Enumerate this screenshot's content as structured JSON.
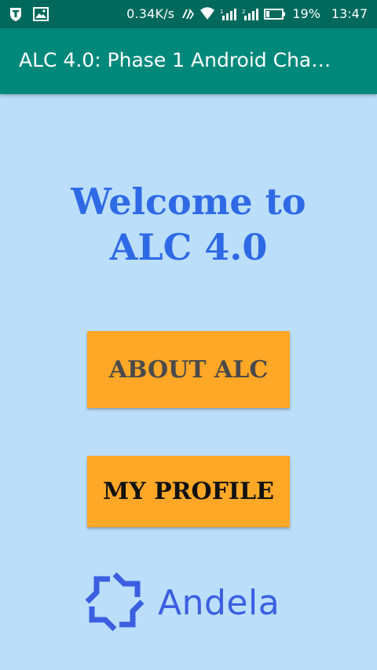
{
  "status_bar": {
    "network_speed": "0.34K/s",
    "battery": "19%",
    "time": "13:47",
    "icons": [
      "shield-notification-icon",
      "image-notification-icon",
      "data-sync-icon",
      "wifi-icon",
      "signal-icon",
      "signal-icon",
      "battery-icon"
    ]
  },
  "app_bar": {
    "title": "ALC 4.0: Phase 1 Android Cha…",
    "background": "#00897b"
  },
  "main": {
    "welcome_text": "Welcome to ALC 4.0",
    "about_button_label": "ABOUT ALC",
    "profile_button_label": "MY PROFILE",
    "button_color": "#ffa726",
    "background": "#bbdefb",
    "accent": "#2e6ae6"
  },
  "logo": {
    "wordmark": "Andela",
    "icon": "andela-logo-icon",
    "color": "#3b5fe0"
  }
}
